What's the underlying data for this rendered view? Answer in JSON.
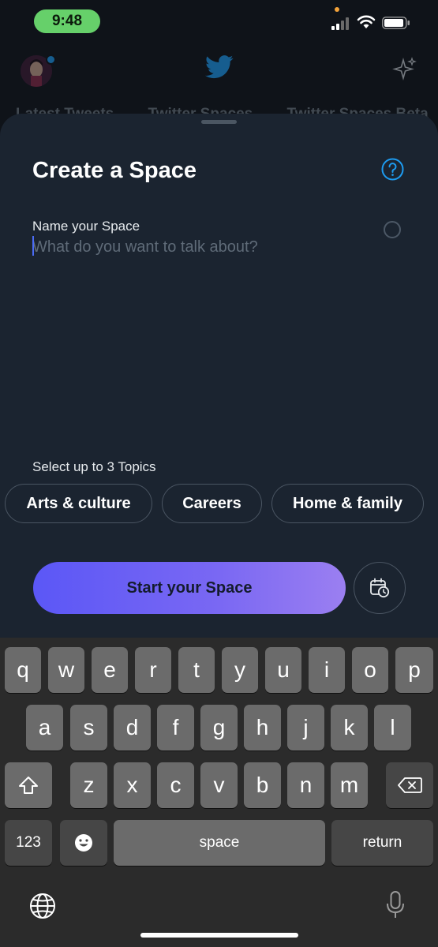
{
  "status": {
    "time": "9:48"
  },
  "header": {
    "tabs": [
      "Latest Tweets",
      "Twitter Spaces",
      "Twitter Spaces Beta"
    ]
  },
  "sheet": {
    "title": "Create a Space",
    "name_label": "Name your Space",
    "name_placeholder": "What do you want to talk about?",
    "name_value": "",
    "topics_label": "Select up to 3 Topics",
    "topics": [
      "Arts & culture",
      "Careers",
      "Home & family"
    ],
    "start_label": "Start your Space"
  },
  "keyboard": {
    "row1": [
      "q",
      "w",
      "e",
      "r",
      "t",
      "y",
      "u",
      "i",
      "o",
      "p"
    ],
    "row2": [
      "a",
      "s",
      "d",
      "f",
      "g",
      "h",
      "j",
      "k",
      "l"
    ],
    "row3": [
      "z",
      "x",
      "c",
      "v",
      "b",
      "n",
      "m"
    ],
    "numbers_label": "123",
    "space_label": "space",
    "return_label": "return"
  },
  "colors": {
    "accent": "#1d9bf0",
    "start_gradient_from": "#5b57f6",
    "start_gradient_to": "#9b7ff1",
    "sheet_bg": "#1b2430"
  }
}
